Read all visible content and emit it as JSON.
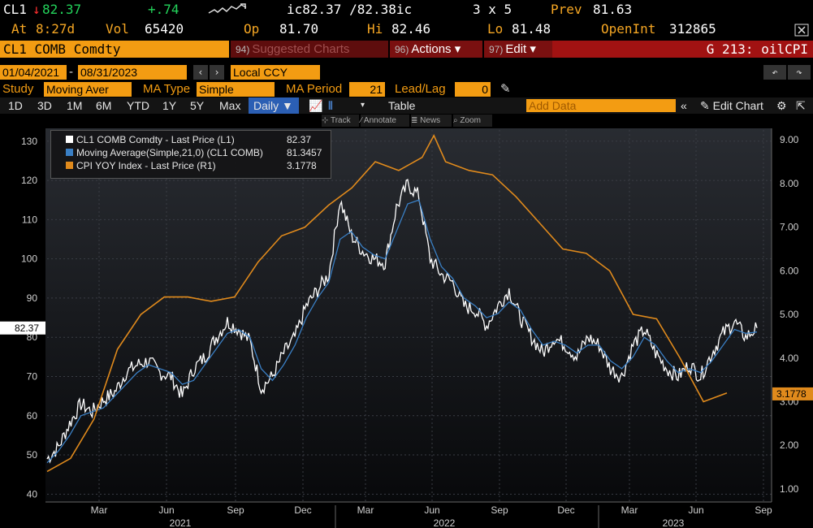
{
  "quote_row1": {
    "ticker": "CL1",
    "arrow": "↓",
    "last": "82.37",
    "change": "+.74",
    "bid_ask": "ic82.37 /82.38ic",
    "size": "3 x 5",
    "prev_label": "Prev",
    "prev": "81.63"
  },
  "quote_row2": {
    "at_label": "At",
    "time": "8:27d",
    "vol_label": "Vol",
    "vol": "65420",
    "op_label": "Op",
    "op": "81.70",
    "hi_label": "Hi",
    "hi": "82.46",
    "lo_label": "Lo",
    "lo": "81.48",
    "oi_label": "OpenInt",
    "oi": "312865"
  },
  "menubar": {
    "security": "CL1 COMB Comdty",
    "suggested_num": "94)",
    "suggested": "Suggested Charts",
    "actions_num": "96)",
    "actions": "Actions",
    "edit_num": "97)",
    "edit": "Edit",
    "graph_code": "G 213: oilCPI"
  },
  "range": {
    "start": "01/04/2021",
    "end": "08/31/2023",
    "currency": "Local CCY"
  },
  "study": {
    "study_label": "Study",
    "study_value": "Moving Aver",
    "ma_type_label": "MA Type",
    "ma_type": "Simple",
    "ma_period_label": "MA Period",
    "ma_period": "21",
    "lead_lag_label": "Lead/Lag",
    "lead_lag": "0"
  },
  "toolbar": {
    "periods": [
      "1D",
      "3D",
      "1M",
      "6M",
      "YTD",
      "1Y",
      "5Y",
      "Max"
    ],
    "freq": "Daily ▼",
    "table": "Table",
    "add_data_placeholder": "Add Data",
    "edit_chart": "Edit Chart"
  },
  "subtools": [
    "Track",
    "Annotate",
    "News",
    "Zoom"
  ],
  "legend": [
    {
      "label": "CL1 COMB Comdty - Last Price (L1)",
      "value": "82.37",
      "color": "#ffffff"
    },
    {
      "label": "Moving Average(Simple,21,0) (CL1 COMB)",
      "value": "81.3457",
      "color": "#3a7fc4"
    },
    {
      "label": "CPI YOY Index - Last Price (R1)",
      "value": "3.1778",
      "color": "#e08a1c"
    }
  ],
  "chart_data": {
    "type": "line",
    "left_axis": {
      "min": 38,
      "max": 137,
      "ticks": [
        40,
        50,
        60,
        70,
        80,
        90,
        100,
        110,
        120,
        130
      ]
    },
    "right_axis": {
      "min": 0.7,
      "max": 9.6,
      "ticks": [
        "1.00",
        "2.00",
        "3.00",
        "4.00",
        "5.00",
        "6.00",
        "7.00",
        "8.00",
        "9.00"
      ]
    },
    "x_labels": [
      "Mar",
      "Jun",
      "Sep",
      "Dec",
      "Mar",
      "Jun",
      "Sep",
      "Dec",
      "Mar",
      "Jun",
      "Sep"
    ],
    "year_labels": [
      "2021",
      "2022",
      "2023"
    ],
    "last_price_tag": "82.37",
    "cpi_tag": "3.1778",
    "series": [
      {
        "name": "CL1 COMB Comdty - Last Price (L1)",
        "points": [
          [
            0,
            49
          ],
          [
            0.5,
            52
          ],
          [
            1,
            58
          ],
          [
            1.5,
            63
          ],
          [
            2,
            61
          ],
          [
            2.5,
            64
          ],
          [
            3,
            66
          ],
          [
            3.5,
            71
          ],
          [
            4,
            73
          ],
          [
            4.5,
            74
          ],
          [
            5,
            71
          ],
          [
            5.5,
            70
          ],
          [
            6,
            65
          ],
          [
            6.5,
            72
          ],
          [
            7,
            75
          ],
          [
            7.5,
            80
          ],
          [
            8,
            84
          ],
          [
            8.5,
            82
          ],
          [
            9,
            79
          ],
          [
            9.5,
            67
          ],
          [
            10,
            70
          ],
          [
            10.5,
            76
          ],
          [
            11,
            80
          ],
          [
            11.5,
            88
          ],
          [
            12,
            92
          ],
          [
            12.5,
            96
          ],
          [
            13,
            115
          ],
          [
            13.5,
            106
          ],
          [
            14,
            102
          ],
          [
            14.5,
            100
          ],
          [
            15,
            99
          ],
          [
            15.5,
            113
          ],
          [
            16,
            119
          ],
          [
            16.5,
            116
          ],
          [
            17,
            100
          ],
          [
            17.5,
            96
          ],
          [
            18,
            94
          ],
          [
            18.5,
            88
          ],
          [
            19,
            87
          ],
          [
            19.5,
            83
          ],
          [
            20,
            88
          ],
          [
            20.5,
            92
          ],
          [
            21,
            85
          ],
          [
            21.5,
            80
          ],
          [
            22,
            76
          ],
          [
            22.5,
            80
          ],
          [
            23,
            78
          ],
          [
            23.5,
            75
          ],
          [
            24,
            80
          ],
          [
            24.5,
            78
          ],
          [
            25,
            72
          ],
          [
            25.5,
            70
          ],
          [
            26,
            78
          ],
          [
            26.5,
            82
          ],
          [
            27,
            76
          ],
          [
            27.5,
            72
          ],
          [
            28,
            70
          ],
          [
            28.5,
            73
          ],
          [
            29,
            70
          ],
          [
            29.5,
            76
          ],
          [
            30,
            81
          ],
          [
            30.5,
            84
          ],
          [
            31,
            80
          ],
          [
            31.5,
            82.37
          ]
        ]
      },
      {
        "name": "Moving Average(Simple,21,0) (CL1 COMB)",
        "points": [
          [
            0,
            48
          ],
          [
            0.5,
            51
          ],
          [
            1,
            55
          ],
          [
            1.5,
            60
          ],
          [
            2,
            61
          ],
          [
            2.5,
            62
          ],
          [
            3,
            65
          ],
          [
            3.5,
            68
          ],
          [
            4,
            71
          ],
          [
            4.5,
            73
          ],
          [
            5,
            72
          ],
          [
            5.5,
            71
          ],
          [
            6,
            68
          ],
          [
            6.5,
            69
          ],
          [
            7,
            73
          ],
          [
            7.5,
            77
          ],
          [
            8,
            81
          ],
          [
            8.5,
            82
          ],
          [
            9,
            80
          ],
          [
            9.5,
            72
          ],
          [
            10,
            69
          ],
          [
            10.5,
            73
          ],
          [
            11,
            78
          ],
          [
            11.5,
            85
          ],
          [
            12,
            90
          ],
          [
            12.5,
            94
          ],
          [
            13,
            105
          ],
          [
            13.5,
            107
          ],
          [
            14,
            103
          ],
          [
            14.5,
            101
          ],
          [
            15,
            100
          ],
          [
            15.5,
            107
          ],
          [
            16,
            114
          ],
          [
            16.5,
            115
          ],
          [
            17,
            105
          ],
          [
            17.5,
            98
          ],
          [
            18,
            95
          ],
          [
            18.5,
            90
          ],
          [
            19,
            88
          ],
          [
            19.5,
            85
          ],
          [
            20,
            86
          ],
          [
            20.5,
            89
          ],
          [
            21,
            87
          ],
          [
            21.5,
            82
          ],
          [
            22,
            78
          ],
          [
            22.5,
            79
          ],
          [
            23,
            78
          ],
          [
            23.5,
            76
          ],
          [
            24,
            78
          ],
          [
            24.5,
            78
          ],
          [
            25,
            74
          ],
          [
            25.5,
            72
          ],
          [
            26,
            75
          ],
          [
            26.5,
            80
          ],
          [
            27,
            78
          ],
          [
            27.5,
            74
          ],
          [
            28,
            71
          ],
          [
            28.5,
            72
          ],
          [
            29,
            71
          ],
          [
            29.5,
            74
          ],
          [
            30,
            78
          ],
          [
            30.5,
            82
          ],
          [
            31,
            81
          ],
          [
            31.5,
            81.35
          ]
        ]
      },
      {
        "name": "CPI YOY Index - Last Price (R1)",
        "points": [
          [
            0,
            1.4
          ],
          [
            1,
            1.7
          ],
          [
            2,
            2.6
          ],
          [
            3,
            4.2
          ],
          [
            4,
            5.0
          ],
          [
            5,
            5.4
          ],
          [
            6,
            5.4
          ],
          [
            7,
            5.3
          ],
          [
            8,
            5.4
          ],
          [
            9,
            6.2
          ],
          [
            10,
            6.8
          ],
          [
            11,
            7.0
          ],
          [
            12,
            7.5
          ],
          [
            13,
            7.9
          ],
          [
            14,
            8.5
          ],
          [
            15,
            8.3
          ],
          [
            16,
            8.6
          ],
          [
            16.5,
            9.1
          ],
          [
            17,
            8.5
          ],
          [
            18,
            8.3
          ],
          [
            19,
            8.2
          ],
          [
            20,
            7.7
          ],
          [
            21,
            7.1
          ],
          [
            22,
            6.5
          ],
          [
            23,
            6.4
          ],
          [
            24,
            6.0
          ],
          [
            25,
            5.0
          ],
          [
            26,
            4.9
          ],
          [
            27,
            4.0
          ],
          [
            28,
            3.0
          ],
          [
            29,
            3.2
          ]
        ]
      }
    ]
  }
}
